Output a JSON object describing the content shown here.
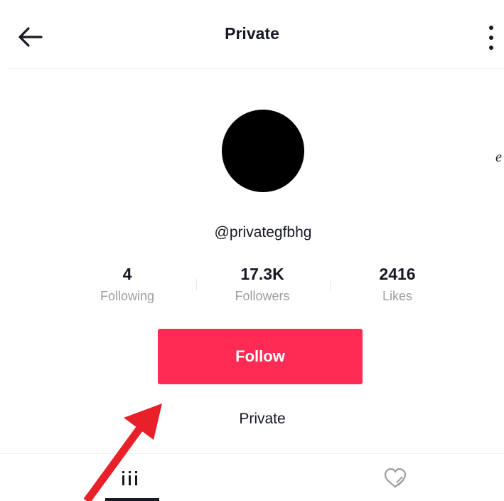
{
  "header": {
    "title": "Private",
    "back_icon": "arrow-left-icon",
    "more_icon": "vertical-ellipsis-icon"
  },
  "edge_glyph": "e",
  "profile": {
    "username": "@privategfbhg"
  },
  "stats": [
    {
      "value": "4",
      "label": "Following"
    },
    {
      "value": "17.3K",
      "label": "Followers"
    },
    {
      "value": "2416",
      "label": "Likes"
    }
  ],
  "follow_button": {
    "label": "Follow",
    "color": "#fe2c55"
  },
  "private_note": "Private",
  "tabs": [
    {
      "icon": "videos-grid-icon",
      "selected": true
    },
    {
      "icon": "liked-heart-icon",
      "selected": false
    }
  ],
  "annotation": {
    "icon": "red-arrow-icon",
    "color": "#e8202a"
  }
}
